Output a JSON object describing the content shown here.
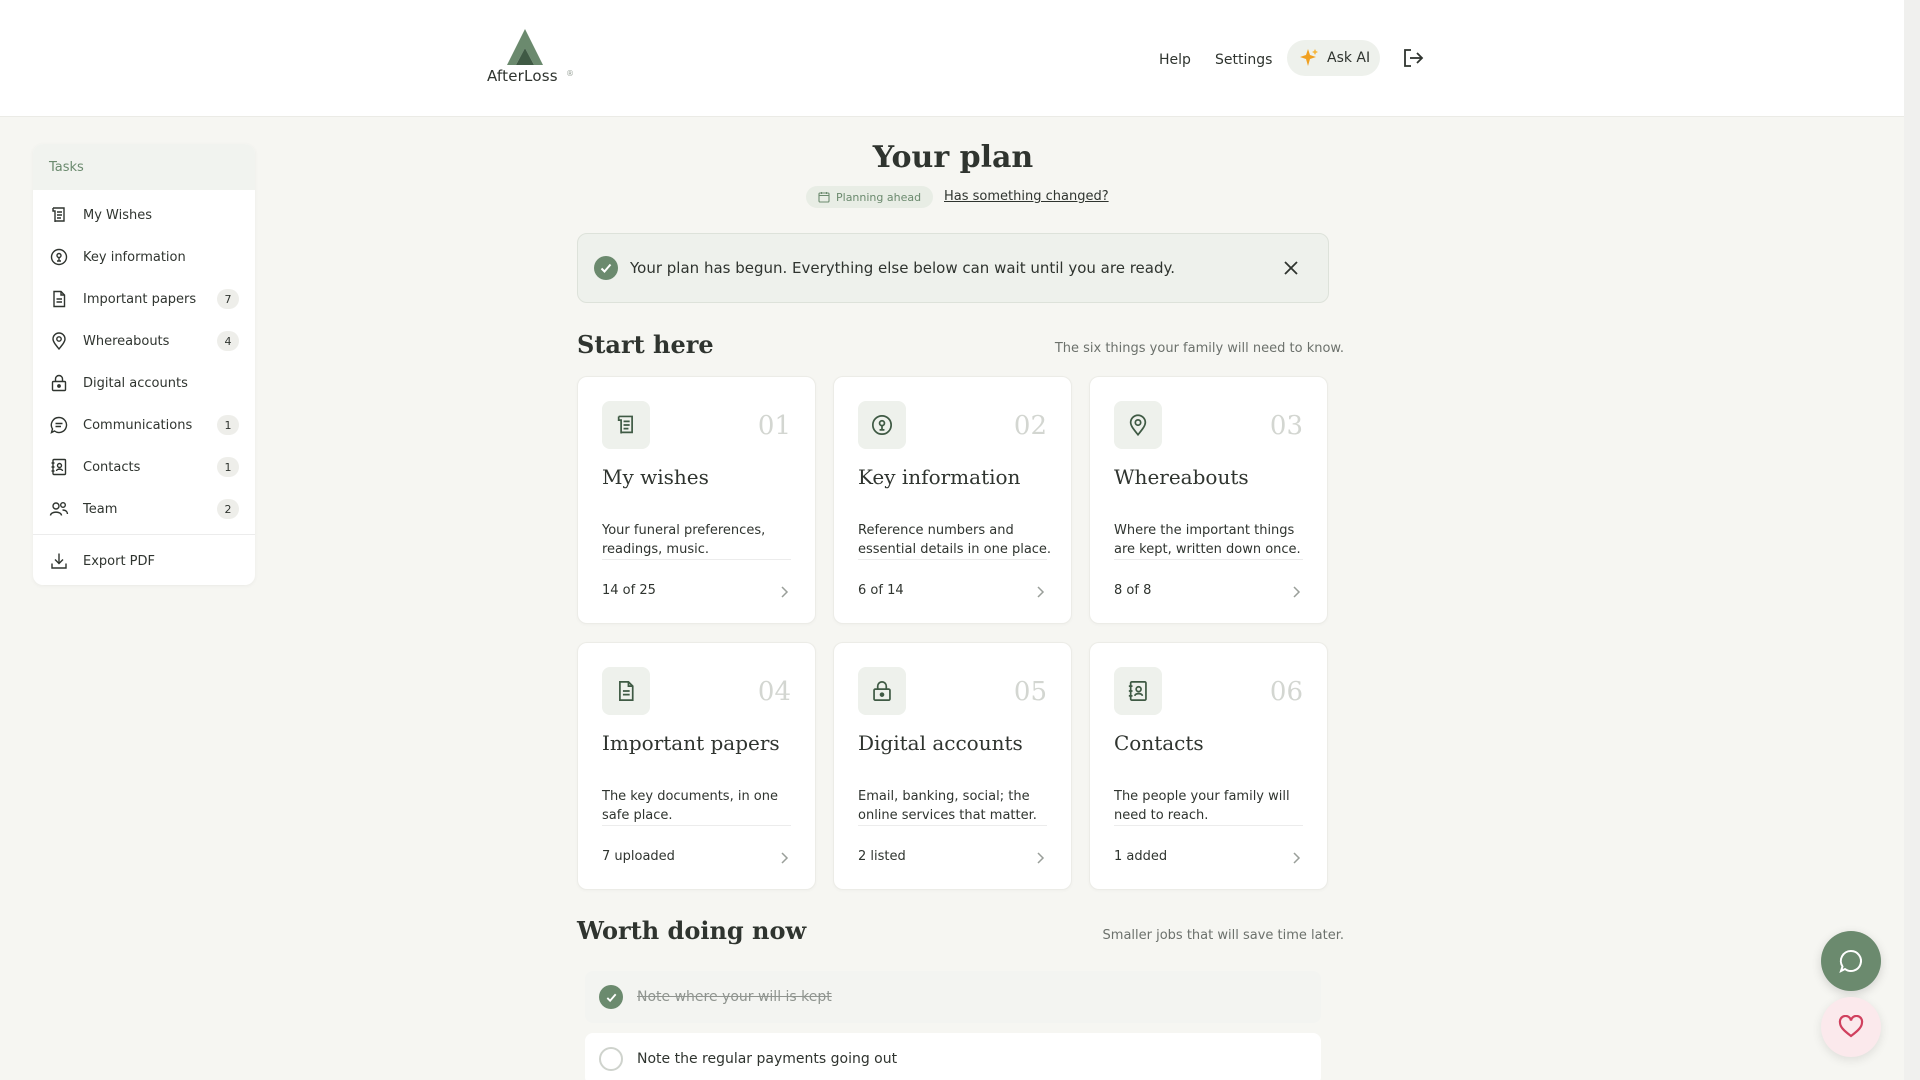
{
  "brand": {
    "name": "AfterLoss",
    "reg": "®"
  },
  "header": {
    "help": "Help",
    "settings": "Settings",
    "ask_ai": "Ask AI"
  },
  "sidebar": {
    "heading": "Tasks",
    "items": [
      {
        "label": "My Wishes",
        "icon": "scroll-icon",
        "badge": ""
      },
      {
        "label": "Key information",
        "icon": "key-lock-icon",
        "badge": ""
      },
      {
        "label": "Important papers",
        "icon": "document-icon",
        "badge": "7"
      },
      {
        "label": "Whereabouts",
        "icon": "map-pin-icon",
        "badge": "4"
      },
      {
        "label": "Digital accounts",
        "icon": "lock-icon",
        "badge": ""
      },
      {
        "label": "Communications",
        "icon": "chat-icon",
        "badge": "1"
      },
      {
        "label": "Contacts",
        "icon": "contact-book-icon",
        "badge": "1"
      },
      {
        "label": "Team",
        "icon": "team-icon",
        "badge": "2"
      }
    ],
    "export": "Export PDF"
  },
  "main": {
    "title": "Your plan",
    "mode_pill": "Planning ahead",
    "changed_link": "Has something changed?",
    "banner": "Your plan has begun. Everything else below can wait until you are ready.",
    "start": {
      "title": "Start here",
      "subtitle": "The six things your family will need to know.",
      "cards": [
        {
          "num": "01",
          "title": "My wishes",
          "desc": "Your funeral preferences, readings, music.",
          "status": "14 of 25",
          "icon": "scroll-icon"
        },
        {
          "num": "02",
          "title": "Key information",
          "desc": "Reference numbers and essential details in one place.",
          "status": "6 of 14",
          "icon": "key-lock-icon"
        },
        {
          "num": "03",
          "title": "Whereabouts",
          "desc": "Where the important things are kept, written down once.",
          "status": "8 of 8",
          "icon": "map-pin-icon"
        },
        {
          "num": "04",
          "title": "Important papers",
          "desc": "The key documents, in one safe place.",
          "status": "7 uploaded",
          "icon": "document-icon"
        },
        {
          "num": "05",
          "title": "Digital accounts",
          "desc": "Email, banking, social; the online services that matter.",
          "status": "2 listed",
          "icon": "lock-icon"
        },
        {
          "num": "06",
          "title": "Contacts",
          "desc": "The people your family will need to reach.",
          "status": "1 added",
          "icon": "contact-book-icon"
        }
      ]
    },
    "worth": {
      "title": "Worth doing now",
      "subtitle": "Smaller jobs that will save time later.",
      "todos": [
        {
          "text": "Note where your will is kept",
          "done": true
        },
        {
          "text": "Note the regular payments going out",
          "done": false
        }
      ]
    }
  },
  "colors": {
    "accent": "#6b8a6e",
    "background": "#f6f6f2",
    "card": "#ffffff"
  }
}
